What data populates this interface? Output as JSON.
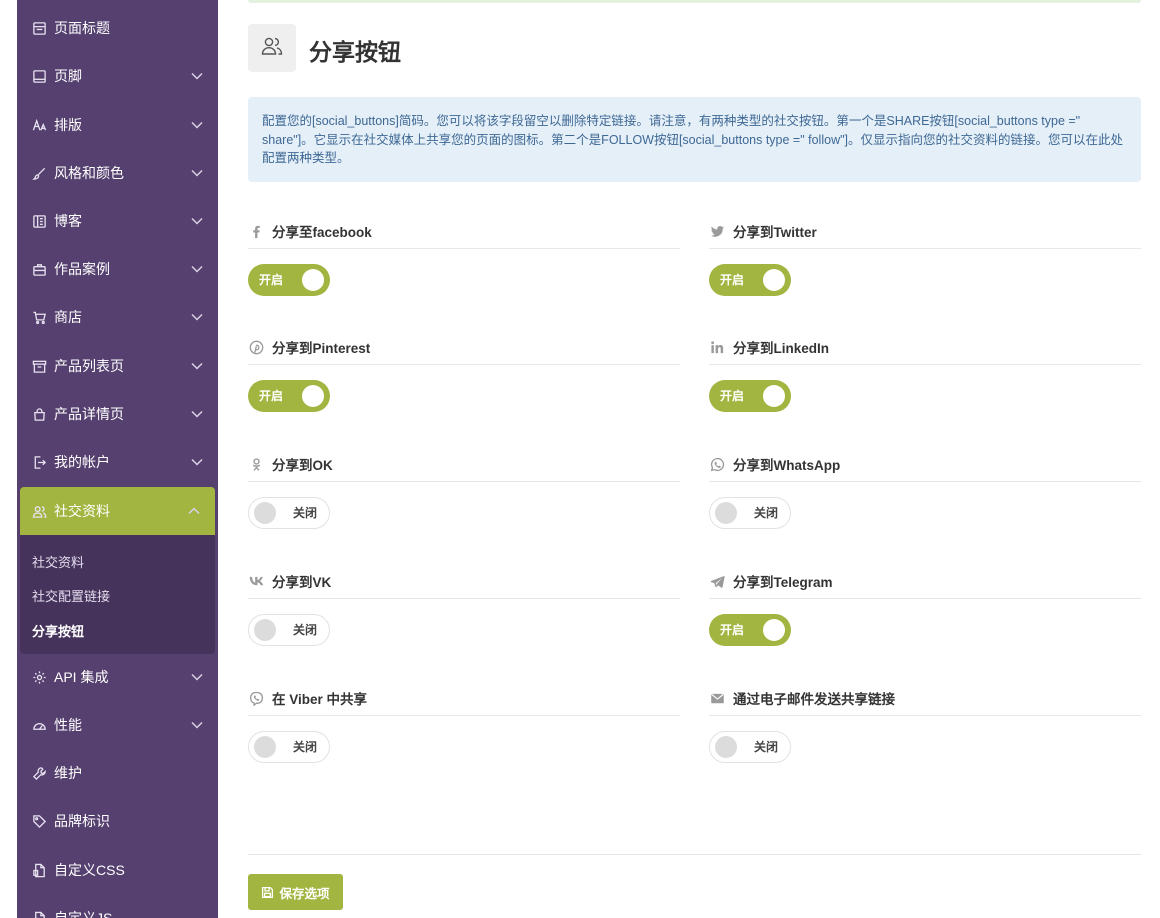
{
  "sidebar": {
    "items": [
      {
        "label": "页面标题",
        "icon": "page-title-icon",
        "chevron": false
      },
      {
        "label": "页脚",
        "icon": "footer-icon",
        "chevron": true
      },
      {
        "label": "排版",
        "icon": "typography-icon",
        "chevron": true
      },
      {
        "label": "风格和颜色",
        "icon": "brush-icon",
        "chevron": true
      },
      {
        "label": "博客",
        "icon": "blog-icon",
        "chevron": true
      },
      {
        "label": "作品案例",
        "icon": "briefcase-icon",
        "chevron": true
      },
      {
        "label": "商店",
        "icon": "cart-icon",
        "chevron": true
      },
      {
        "label": "产品列表页",
        "icon": "archive-icon",
        "chevron": true
      },
      {
        "label": "产品详情页",
        "icon": "bag-icon",
        "chevron": true
      },
      {
        "label": "我的帐户",
        "icon": "account-icon",
        "chevron": true
      },
      {
        "label": "社交资料",
        "icon": "users-icon",
        "chevron": true,
        "active": true
      },
      {
        "label": "API 集成",
        "icon": "gear-icon",
        "chevron": true
      },
      {
        "label": "性能",
        "icon": "gauge-icon",
        "chevron": true
      },
      {
        "label": "维护",
        "icon": "wrench-icon",
        "chevron": false
      },
      {
        "label": "品牌标识",
        "icon": "tag-icon",
        "chevron": false
      },
      {
        "label": "自定义CSS",
        "icon": "css-file-icon",
        "chevron": false
      },
      {
        "label": "自定义JS",
        "icon": "js-file-icon",
        "chevron": false
      }
    ],
    "submenu": [
      "社交资料",
      "社交配置链接",
      "分享按钮"
    ]
  },
  "page": {
    "title": "分享按钮",
    "icon": "users-icon",
    "info": "配置您的[social_buttons]简码。您可以将该字段留空以删除特定链接。请注意，有两种类型的社交按钮。第一个是SHARE按钮[social_buttons type =\" share\"]。它显示在社交媒体上共享您的页面的图标。第二个是FOLLOW按钮[social_buttons type =\" follow\"]。仅显示指向您的社交资料的链接。您可以在此处配置两种类型。"
  },
  "toggle_labels": {
    "on": "开启",
    "off": "关闭"
  },
  "fields": [
    {
      "label": "分享至facebook",
      "icon": "facebook-icon",
      "state": "on"
    },
    {
      "label": "分享到Twitter",
      "icon": "twitter-icon",
      "state": "on"
    },
    {
      "label": "分享到Pinterest",
      "icon": "pinterest-icon",
      "state": "on"
    },
    {
      "label": "分享到LinkedIn",
      "icon": "linkedin-icon",
      "state": "on"
    },
    {
      "label": "分享到OK",
      "icon": "odnoklassniki-icon",
      "state": "off"
    },
    {
      "label": "分享到WhatsApp",
      "icon": "whatsapp-icon",
      "state": "off"
    },
    {
      "label": "分享到VK",
      "icon": "vk-icon",
      "state": "off"
    },
    {
      "label": "分享到Telegram",
      "icon": "telegram-icon",
      "state": "on"
    },
    {
      "label": "在 Viber 中共享",
      "icon": "viber-icon",
      "state": "off"
    },
    {
      "label": "通过电子邮件发送共享链接",
      "icon": "envelope-icon",
      "state": "off"
    }
  ],
  "save_label": "保存选项",
  "colors": {
    "sidebar": "#55406f",
    "accent": "#a3b541",
    "submenu": "#45335c",
    "info_bg": "#e5eff8",
    "info_text": "#3e6894"
  }
}
